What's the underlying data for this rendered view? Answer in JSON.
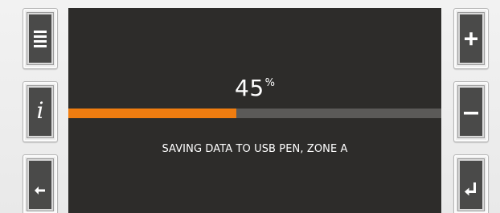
{
  "progress": {
    "value": "45",
    "unit": "%",
    "fraction": 0.45
  },
  "status": {
    "message": "SAVING DATA TO USB PEN, ZONE A"
  },
  "buttons": {
    "left": [
      {
        "name": "menu",
        "icon": "menu-icon"
      },
      {
        "name": "info",
        "icon": "info-icon",
        "glyph": "i"
      },
      {
        "name": "back",
        "icon": "arrow-left-icon"
      }
    ],
    "right": [
      {
        "name": "increase",
        "icon": "plus-icon"
      },
      {
        "name": "decrease",
        "icon": "minus-icon"
      },
      {
        "name": "enter",
        "icon": "enter-icon"
      }
    ]
  },
  "colors": {
    "screen_background": "#2d2c2a",
    "progress_fill": "#f07d10",
    "progress_track": "#5b5a58",
    "text": "#ffffff",
    "button_face": "#4a4a49"
  }
}
